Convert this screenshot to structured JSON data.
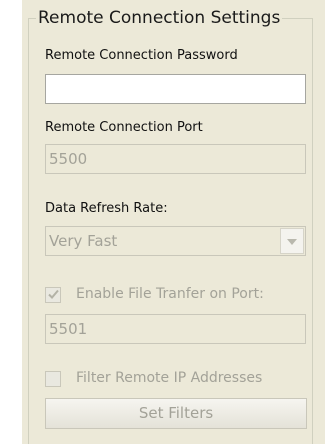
{
  "group": {
    "title": "Remote Connection Settings"
  },
  "password": {
    "label": "Remote Connection Password",
    "value": ""
  },
  "port": {
    "label": "Remote Connection Port",
    "value": "5500"
  },
  "refresh": {
    "label": "Data Refresh Rate:",
    "selected": "Very Fast"
  },
  "file_transfer": {
    "label": "Enable File Tranfer on Port:",
    "checked": true,
    "port_value": "5501"
  },
  "filter": {
    "label": "Filter Remote IP Addresses",
    "checked": false,
    "button_label": "Set Filters"
  },
  "icons": {
    "combo_arrow": "chevron-down-icon",
    "check": "checkmark-icon"
  },
  "colors": {
    "panel_bg": "#ece9d8",
    "disabled_text": "#a3a298",
    "group_border": "#d0d0bf"
  }
}
